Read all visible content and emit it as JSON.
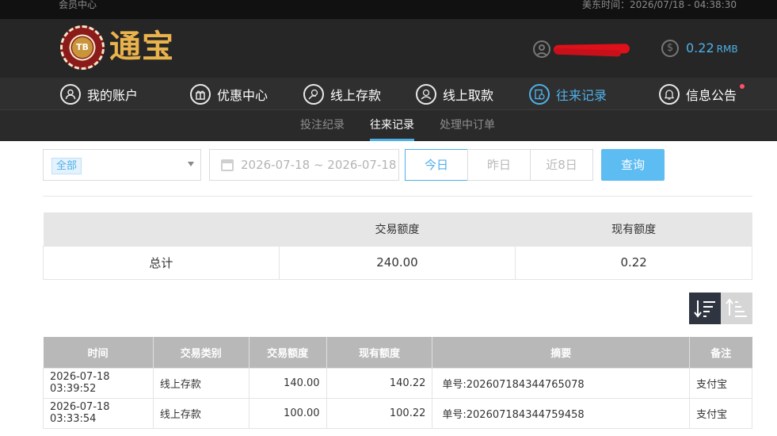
{
  "topbar": {
    "left_text": "会员中心",
    "right_text": "美东时间：2026/07/18 - 04:38:30"
  },
  "header": {
    "chip_text": "TB",
    "brand": "通宝",
    "balance_value": "0.22",
    "balance_unit": "RMB"
  },
  "main_nav": [
    {
      "label": "我的账户",
      "icon": "user-icon"
    },
    {
      "label": "优惠中心",
      "icon": "gift-icon"
    },
    {
      "label": "线上存款",
      "icon": "deposit-icon"
    },
    {
      "label": "线上取款",
      "icon": "withdraw-icon"
    },
    {
      "label": "往来记录",
      "icon": "records-icon",
      "active": true
    },
    {
      "label": "信息公告",
      "icon": "bell-icon"
    }
  ],
  "sub_nav": [
    {
      "label": "投注纪录"
    },
    {
      "label": "往来记录",
      "active": true
    },
    {
      "label": "处理中订单"
    }
  ],
  "filters": {
    "type_selected": "全部",
    "date_range": "2026-07-18 ~ 2026-07-18",
    "quick_ranges": [
      "今日",
      "昨日",
      "近8日"
    ],
    "query_label": "查询"
  },
  "summary": {
    "headers": [
      "",
      "交易额度",
      "现有额度"
    ],
    "row": [
      "总计",
      "240.00",
      "0.22"
    ]
  },
  "records": {
    "headers": [
      "时间",
      "交易类别",
      "交易额度",
      "现有额度",
      "摘要",
      "备注"
    ],
    "rows": [
      [
        "2026-07-18 03:39:52",
        "线上存款",
        "140.00",
        "140.22",
        "单号:202607184344765078",
        "支付宝"
      ],
      [
        "2026-07-18 03:33:54",
        "线上存款",
        "100.00",
        "100.22",
        "单号:202607184344759458",
        "支付宝"
      ]
    ]
  },
  "colors": {
    "accent": "#4fb0e8",
    "brand_gold": "#e9b24c",
    "nav_bg": "#2f2f2f"
  }
}
